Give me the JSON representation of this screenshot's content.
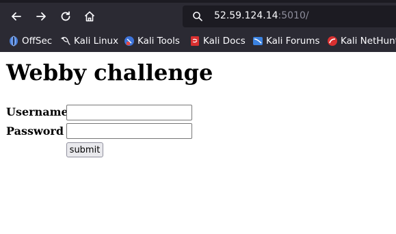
{
  "browser": {
    "url_host": "52.59.124.14",
    "url_port": ":5010/",
    "bookmarks": [
      {
        "label": "OffSec",
        "icon": "offsec-icon"
      },
      {
        "label": "Kali Linux",
        "icon": "kali-dragon-icon"
      },
      {
        "label": "Kali Tools",
        "icon": "kali-tools-icon"
      },
      {
        "label": "Kali Docs",
        "icon": "kali-docs-icon"
      },
      {
        "label": "Kali Forums",
        "icon": "kali-forums-icon"
      },
      {
        "label": "Kali NetHunter",
        "icon": "kali-nethunter-icon"
      }
    ]
  },
  "page": {
    "title": "Webby challenge",
    "form": {
      "username_label": "Username",
      "password_label": "Password",
      "username_value": "",
      "password_value": "",
      "submit_label": "submit"
    }
  },
  "colors": {
    "chrome_bg": "#2b2a33",
    "urlbar_bg": "#1c1b22",
    "text_light": "#fbfbfe",
    "url_port": "#8f8f9d"
  }
}
